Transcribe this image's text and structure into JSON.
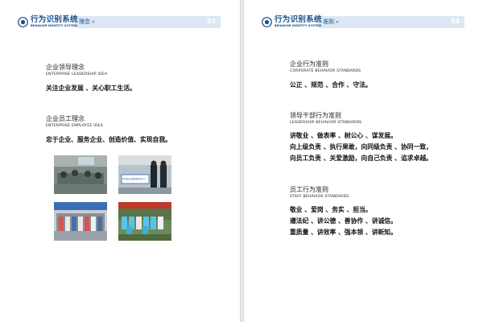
{
  "header": {
    "title": "行为识别系统",
    "subtitle": "BEHAVIOR IDENTITY SYSTEM",
    "arrows": "»"
  },
  "left": {
    "crumb": "理念",
    "page_no": "53",
    "sections": [
      {
        "title": "企业领导理念",
        "en": "ENTERPRISE LEADERSHIP IDEA",
        "body": [
          "关注企业发展 、关心职工生活。"
        ]
      },
      {
        "title": "企业员工理念",
        "en": "ENTERPRISE EMPLOYEE IDEA",
        "body": [
          "忠于企业、服务企业、创造价值、实现自我。"
        ]
      }
    ],
    "photo_banner_text": "中铁四局运输管理有限公司"
  },
  "right": {
    "crumb": "准则",
    "page_no": "54",
    "sections": [
      {
        "title": "企业行为准则",
        "en": "CORPORATE BEHAVIOR STANDARDS",
        "body": [
          "公正 、规范 、合作 、守法。"
        ]
      },
      {
        "title": "领导干部行为准则",
        "en": "LEADERSHIP BEHAVIOR STANDARDS",
        "body": [
          "讲敬业 、做表率 、树公心 、谋发展。",
          "向上级负责 、执行果敢，向同级负责 、协同一致，",
          "向员工负责 、关爱激励，向自己负责 、追求卓越。"
        ]
      },
      {
        "title": "员工行为准则",
        "en": "STAFF BEHAVIOR STANDARDS",
        "body": [
          "敬业 、爱岗 、务实 、担当。",
          "遵法纪 、讲公德 、善协作 、讲诚信。",
          "重质量 、讲效率 、强本领 、讲新知。"
        ]
      }
    ]
  },
  "colors": {
    "brand": "#1a4f87",
    "header_bar": "#dbe8f3",
    "text": "#111111"
  }
}
